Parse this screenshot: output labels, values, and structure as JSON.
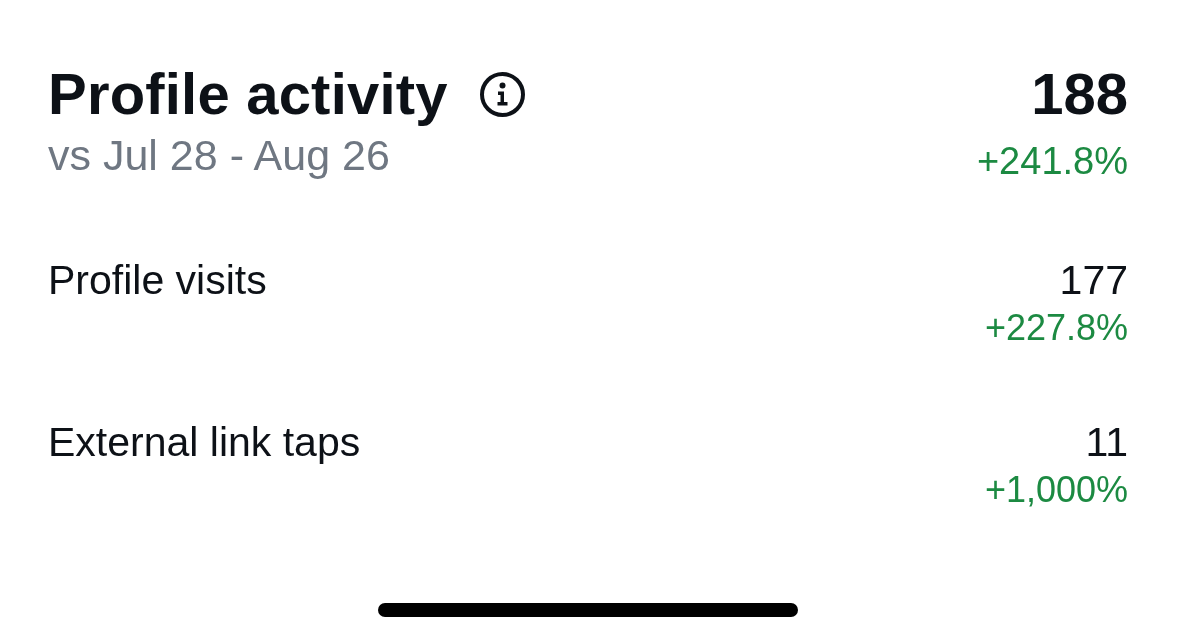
{
  "header": {
    "title": "Profile activity",
    "subtitle": "vs Jul 28 - Aug 26",
    "total": "188",
    "change": "+241.8%"
  },
  "metrics": [
    {
      "label": "Profile visits",
      "value": "177",
      "change": "+227.8%"
    },
    {
      "label": "External link taps",
      "value": "11",
      "change": "+1,000%"
    }
  ]
}
